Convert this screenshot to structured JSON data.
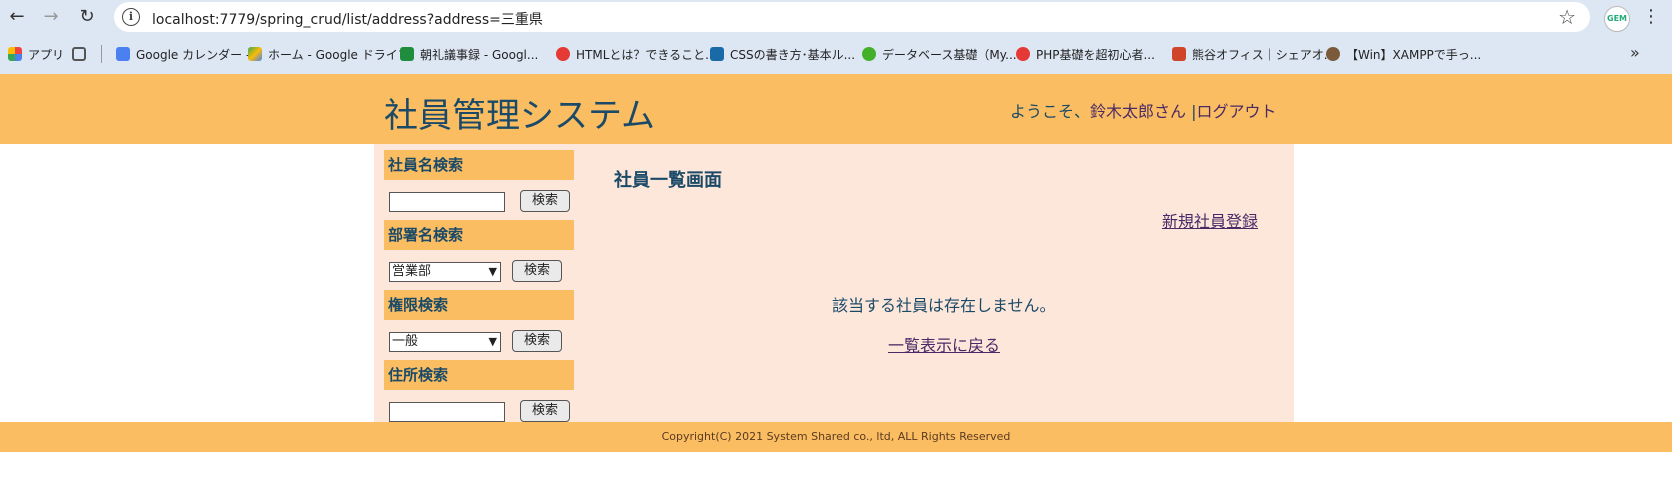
{
  "browser": {
    "url": "localhost:7779/spring_crud/list/address?address=三重県",
    "profile_badge": "GEM",
    "bookmarks": [
      {
        "label": "アプリ",
        "icon": "apps-grid-icon",
        "color": "#e44"
      },
      {
        "label": "",
        "icon": "tab-groups-icon",
        "color": "#555"
      },
      {
        "label": "Google カレンダー -",
        "icon": "calendar-icon",
        "color": "#4a80f0"
      },
      {
        "label": "ホーム - Google ドライブ",
        "icon": "drive-icon",
        "color": "#34a853"
      },
      {
        "label": "朝礼議事録 - Googl...",
        "icon": "sheets-icon",
        "color": "#1e8e3e"
      },
      {
        "label": "HTMLとは？できること...",
        "icon": "red-circle-icon",
        "color": "#e53935"
      },
      {
        "label": "CSSの書き方･基本ル...",
        "icon": "css-site-icon",
        "color": "#1a6aa8"
      },
      {
        "label": "データベース基礎（My...",
        "icon": "green-circle-icon",
        "color": "#43b02a"
      },
      {
        "label": "PHP基礎を超初心者...",
        "icon": "red-circle-icon",
        "color": "#e53935"
      },
      {
        "label": "熊谷オフィス｜シェアオ...",
        "icon": "k-logo-icon",
        "color": "#d0452a"
      },
      {
        "label": "【Win】XAMPPで手っ...",
        "icon": "avatar-icon",
        "color": "#7a5a3a"
      }
    ]
  },
  "header": {
    "title": "社員管理システム",
    "welcome_prefix": "ようこそ、",
    "user_name": "鈴木太郎さん",
    "separator": " |",
    "logout": "ログアウト"
  },
  "sidebar": {
    "name_search": {
      "heading": "社員名検索",
      "button": "検索"
    },
    "dept_search": {
      "heading": "部署名検索",
      "selected": "営業部",
      "button": "検索"
    },
    "role_search": {
      "heading": "権限検索",
      "selected": "一般",
      "button": "検索"
    },
    "address_search": {
      "heading": "住所検索",
      "button": "検索"
    }
  },
  "main": {
    "title": "社員一覧画面",
    "new_link": "新規社員登録",
    "empty_message": "該当する社員は存在しません。",
    "back_link": "一覧表示に戻る"
  },
  "footer": {
    "copyright": "Copyright(C) 2021 System Shared co., ltd, ALL Rights Reserved"
  }
}
